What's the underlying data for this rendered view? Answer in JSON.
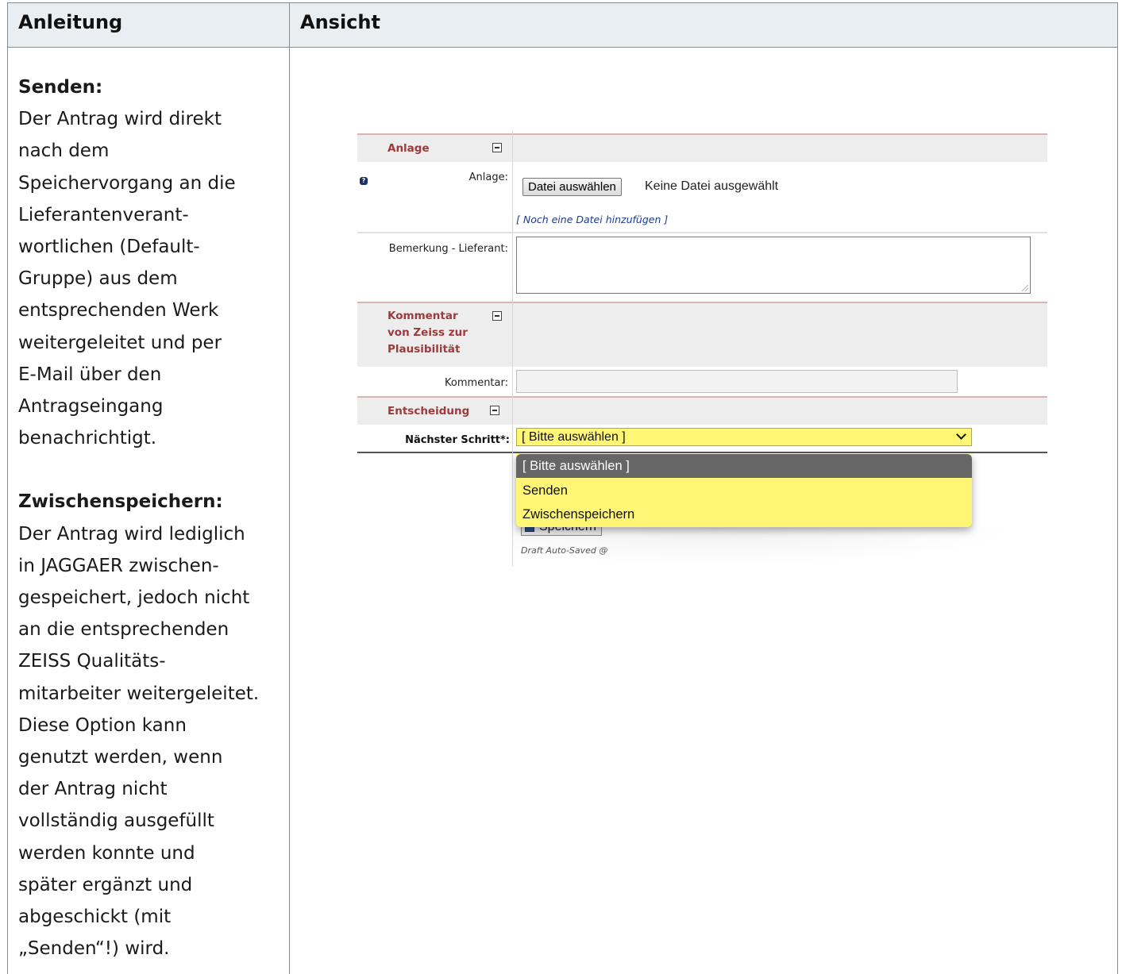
{
  "header": {
    "col_left": "Anleitung",
    "col_right": "Ansicht"
  },
  "instructions": {
    "send_heading": "Senden:",
    "send_lines": [
      "Der Antrag wird direkt",
      "nach dem",
      "Speichervorgang an die",
      "Lieferantenverant-",
      "wortlichen (Default-",
      "Gruppe) aus dem",
      "entsprechenden Werk",
      "weitergeleitet und per",
      "E-Mail über den",
      "Antragseingang",
      "benachrichtigt."
    ],
    "save_heading": "Zwischenspeichern:",
    "save_lines": [
      "Der Antrag wird lediglich",
      "in JAGGAER zwischen-",
      "gespeichert, jedoch nicht",
      "an die entsprechenden",
      "ZEISS Qualitäts-",
      "mitarbeiter weitergeleitet.",
      "Diese Option kann",
      "genutzt werden, wenn",
      "der Antrag nicht",
      "vollständig ausgefüllt",
      "werden konnte und",
      "später ergänzt und",
      "abgeschickt (mit",
      "„Senden“!) wird."
    ]
  },
  "form": {
    "section_anlage": "Anlage",
    "label_anlage": "Anlage:",
    "help_icon": "?",
    "file_button": "Datei auswählen",
    "file_status": "Keine Datei ausgewählt",
    "add_file_link": "[ Noch eine Datei hinzufügen ]",
    "label_bemerkung": "Bemerkung - Lieferant:",
    "section_kommentar_lines": [
      "Kommentar",
      "von Zeiss zur",
      "Plausibilität"
    ],
    "label_kommentar": "Kommentar:",
    "section_entscheidung": "Entscheidung",
    "label_next_step": "Nächster Schritt*:",
    "select_value": "[ Bitte auswählen ]",
    "save_button": "Speichern",
    "autosave_text": "Draft Auto-Saved @"
  },
  "dropdown": {
    "options": [
      "[ Bitte auswählen ]",
      "Senden",
      "Zwischenspeichern"
    ],
    "highlighted_index": 0
  },
  "colors": {
    "header_bg": "#e8eef2",
    "section_title": "#9e3a3a",
    "select_bg": "#fff676",
    "option_highlight": "#666666"
  }
}
